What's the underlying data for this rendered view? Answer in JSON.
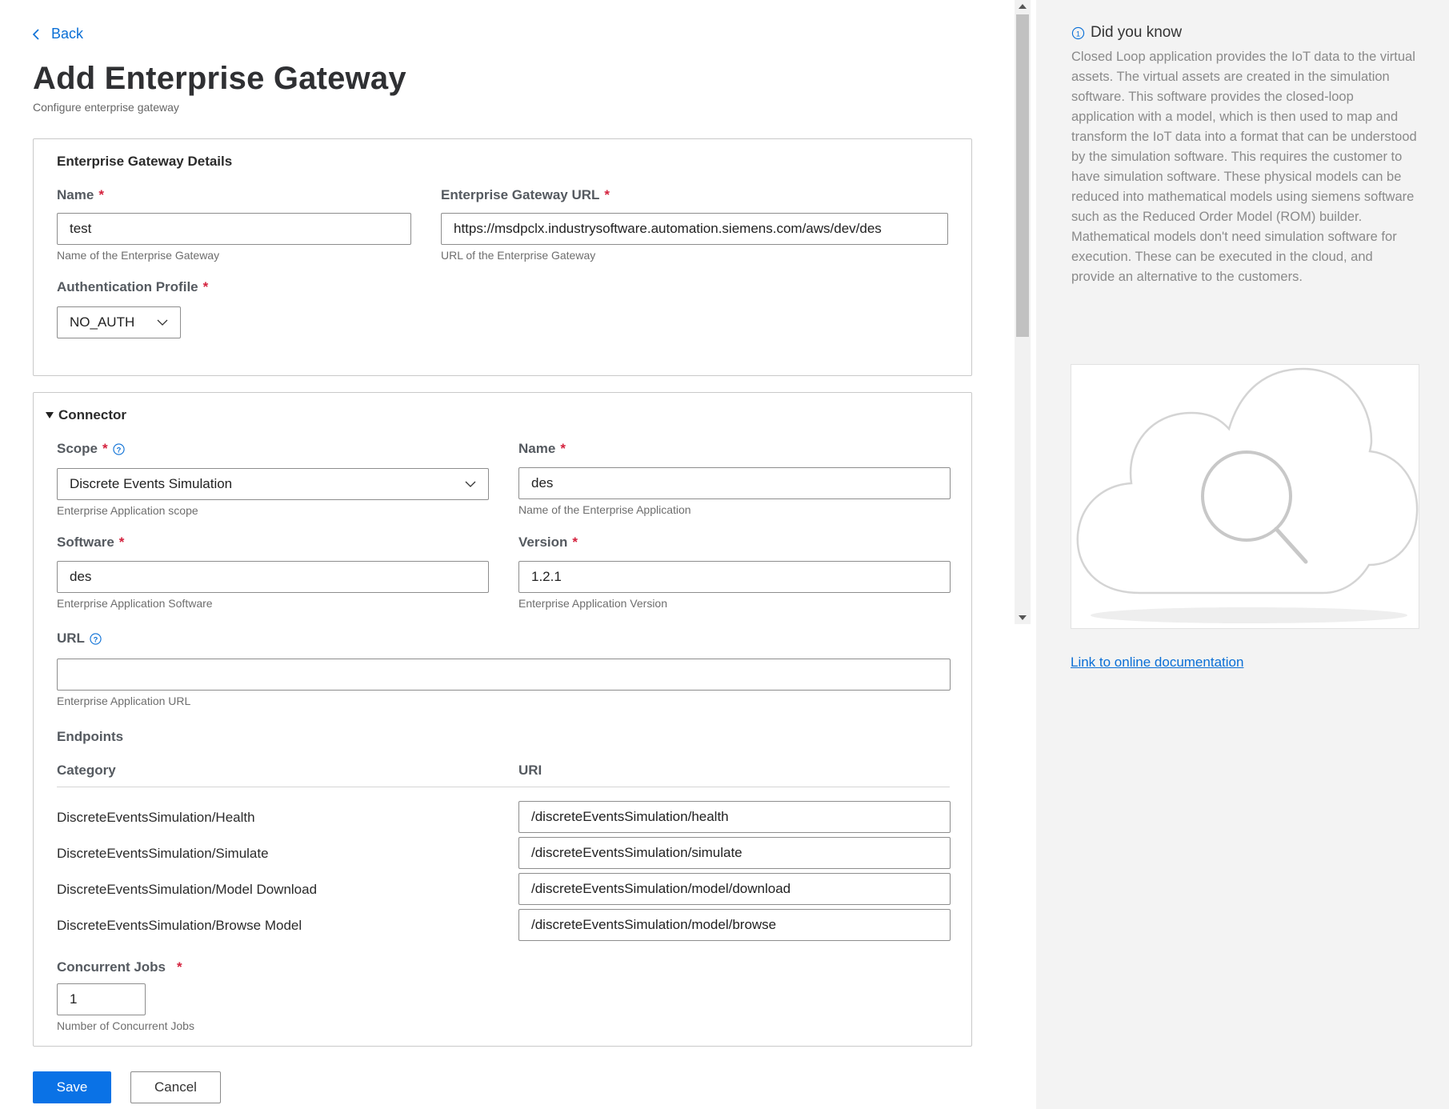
{
  "header": {
    "back_label": "Back",
    "title": "Add Enterprise Gateway",
    "subtitle": "Configure enterprise gateway"
  },
  "gateway_details": {
    "section_title": "Enterprise Gateway Details",
    "name": {
      "label": "Name",
      "value": "test",
      "help": "Name of the Enterprise Gateway"
    },
    "url": {
      "label": "Enterprise Gateway URL",
      "value": "https://msdpclx.industrysoftware.automation.siemens.com/aws/dev/des",
      "help": "URL of the Enterprise Gateway"
    },
    "auth_profile": {
      "label": "Authentication Profile",
      "value": "NO_AUTH"
    }
  },
  "connector": {
    "section_title": "Connector",
    "scope": {
      "label": "Scope",
      "value": "Discrete Events Simulation",
      "help": "Enterprise Application scope"
    },
    "name": {
      "label": "Name",
      "value": "des",
      "help": "Name of the Enterprise Application"
    },
    "software": {
      "label": "Software",
      "value": "des",
      "help": "Enterprise Application Software"
    },
    "version": {
      "label": "Version",
      "value": "1.2.1",
      "help": "Enterprise Application Version"
    },
    "url": {
      "label": "URL",
      "value": "",
      "help": "Enterprise Application URL"
    },
    "endpoints": {
      "title": "Endpoints",
      "col_category": "Category",
      "col_uri": "URI",
      "rows": [
        {
          "category": "DiscreteEventsSimulation/Health",
          "uri": "/discreteEventsSimulation/health"
        },
        {
          "category": "DiscreteEventsSimulation/Simulate",
          "uri": "/discreteEventsSimulation/simulate"
        },
        {
          "category": "DiscreteEventsSimulation/Model Download",
          "uri": "/discreteEventsSimulation/model/download"
        },
        {
          "category": "DiscreteEventsSimulation/Browse Model",
          "uri": "/discreteEventsSimulation/model/browse"
        }
      ]
    },
    "concurrent_jobs": {
      "label": "Concurrent Jobs",
      "value": "1",
      "help": "Number of Concurrent Jobs"
    }
  },
  "actions": {
    "save_label": "Save",
    "cancel_label": "Cancel"
  },
  "sidebar": {
    "title": "Did you know",
    "body": "Closed Loop application provides the IoT data to the virtual assets. The virtual assets are created in the simulation software. This software provides the closed-loop application with a model, which is then used to map and transform the IoT data into a format that can be understood by the simulation software. This requires the customer to have simulation software. These physical models can be reduced into mathematical models using siemens software such as the Reduced Order Model (ROM) builder. Mathematical models don't need simulation software for execution. These can be executed in the cloud, and provide an alternative to the customers.",
    "link_label": "Link to online documentation"
  },
  "colors": {
    "accent": "#0a72e6",
    "required": "#d4213d",
    "sidebar_bg": "#f3f3f3"
  },
  "icons": [
    "chevron-left-icon",
    "chevron-down-icon",
    "help-circle-icon",
    "info-icon",
    "cloud-search-icon",
    "triangle-down-icon"
  ]
}
